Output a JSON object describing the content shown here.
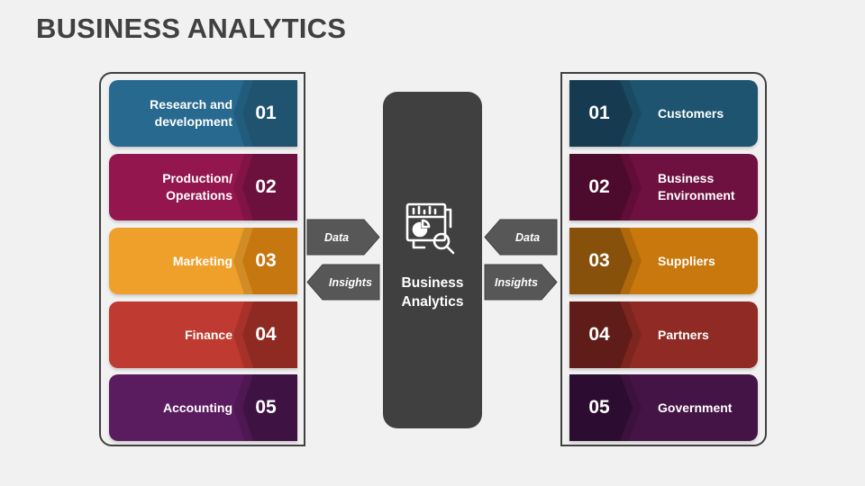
{
  "title": "BUSINESS ANALYTICS",
  "center": {
    "title_line1": "Business",
    "title_line2": "Analytics",
    "icon": "analytics-report-search-icon"
  },
  "arrows": {
    "left_data": "Data",
    "left_insights": "Insights",
    "right_data": "Data",
    "right_insights": "Insights"
  },
  "left_list": [
    {
      "number": "01",
      "line1": "Research and",
      "line2": "development",
      "color": "#27698f",
      "dark": "#1f5370"
    },
    {
      "number": "02",
      "line1": "Production/",
      "line2": "Operations",
      "color": "#94164f",
      "dark": "#6c103d"
    },
    {
      "number": "03",
      "line1": "Marketing",
      "line2": "",
      "color": "#efa02b",
      "dark": "#c6770f"
    },
    {
      "number": "04",
      "line1": "Finance",
      "line2": "",
      "color": "#bf3a30",
      "dark": "#8f2a22"
    },
    {
      "number": "05",
      "line1": "Accounting",
      "line2": "",
      "color": "#5b1c5f",
      "dark": "#3f1244"
    }
  ],
  "right_list": [
    {
      "number": "01",
      "line1": "Customers",
      "line2": "",
      "color": "#1e5470",
      "dark": "#163a50"
    },
    {
      "number": "02",
      "line1": "Business",
      "line2": "Environment",
      "color": "#6e1040",
      "dark": "#4c0a2c"
    },
    {
      "number": "03",
      "line1": "Suppliers",
      "line2": "",
      "color": "#c8780c",
      "dark": "#87510b"
    },
    {
      "number": "04",
      "line1": "Partners",
      "line2": "",
      "color": "#8f2b24",
      "dark": "#5f1c18"
    },
    {
      "number": "05",
      "line1": "Government",
      "line2": "",
      "color": "#451446",
      "dark": "#2c0c30"
    }
  ]
}
